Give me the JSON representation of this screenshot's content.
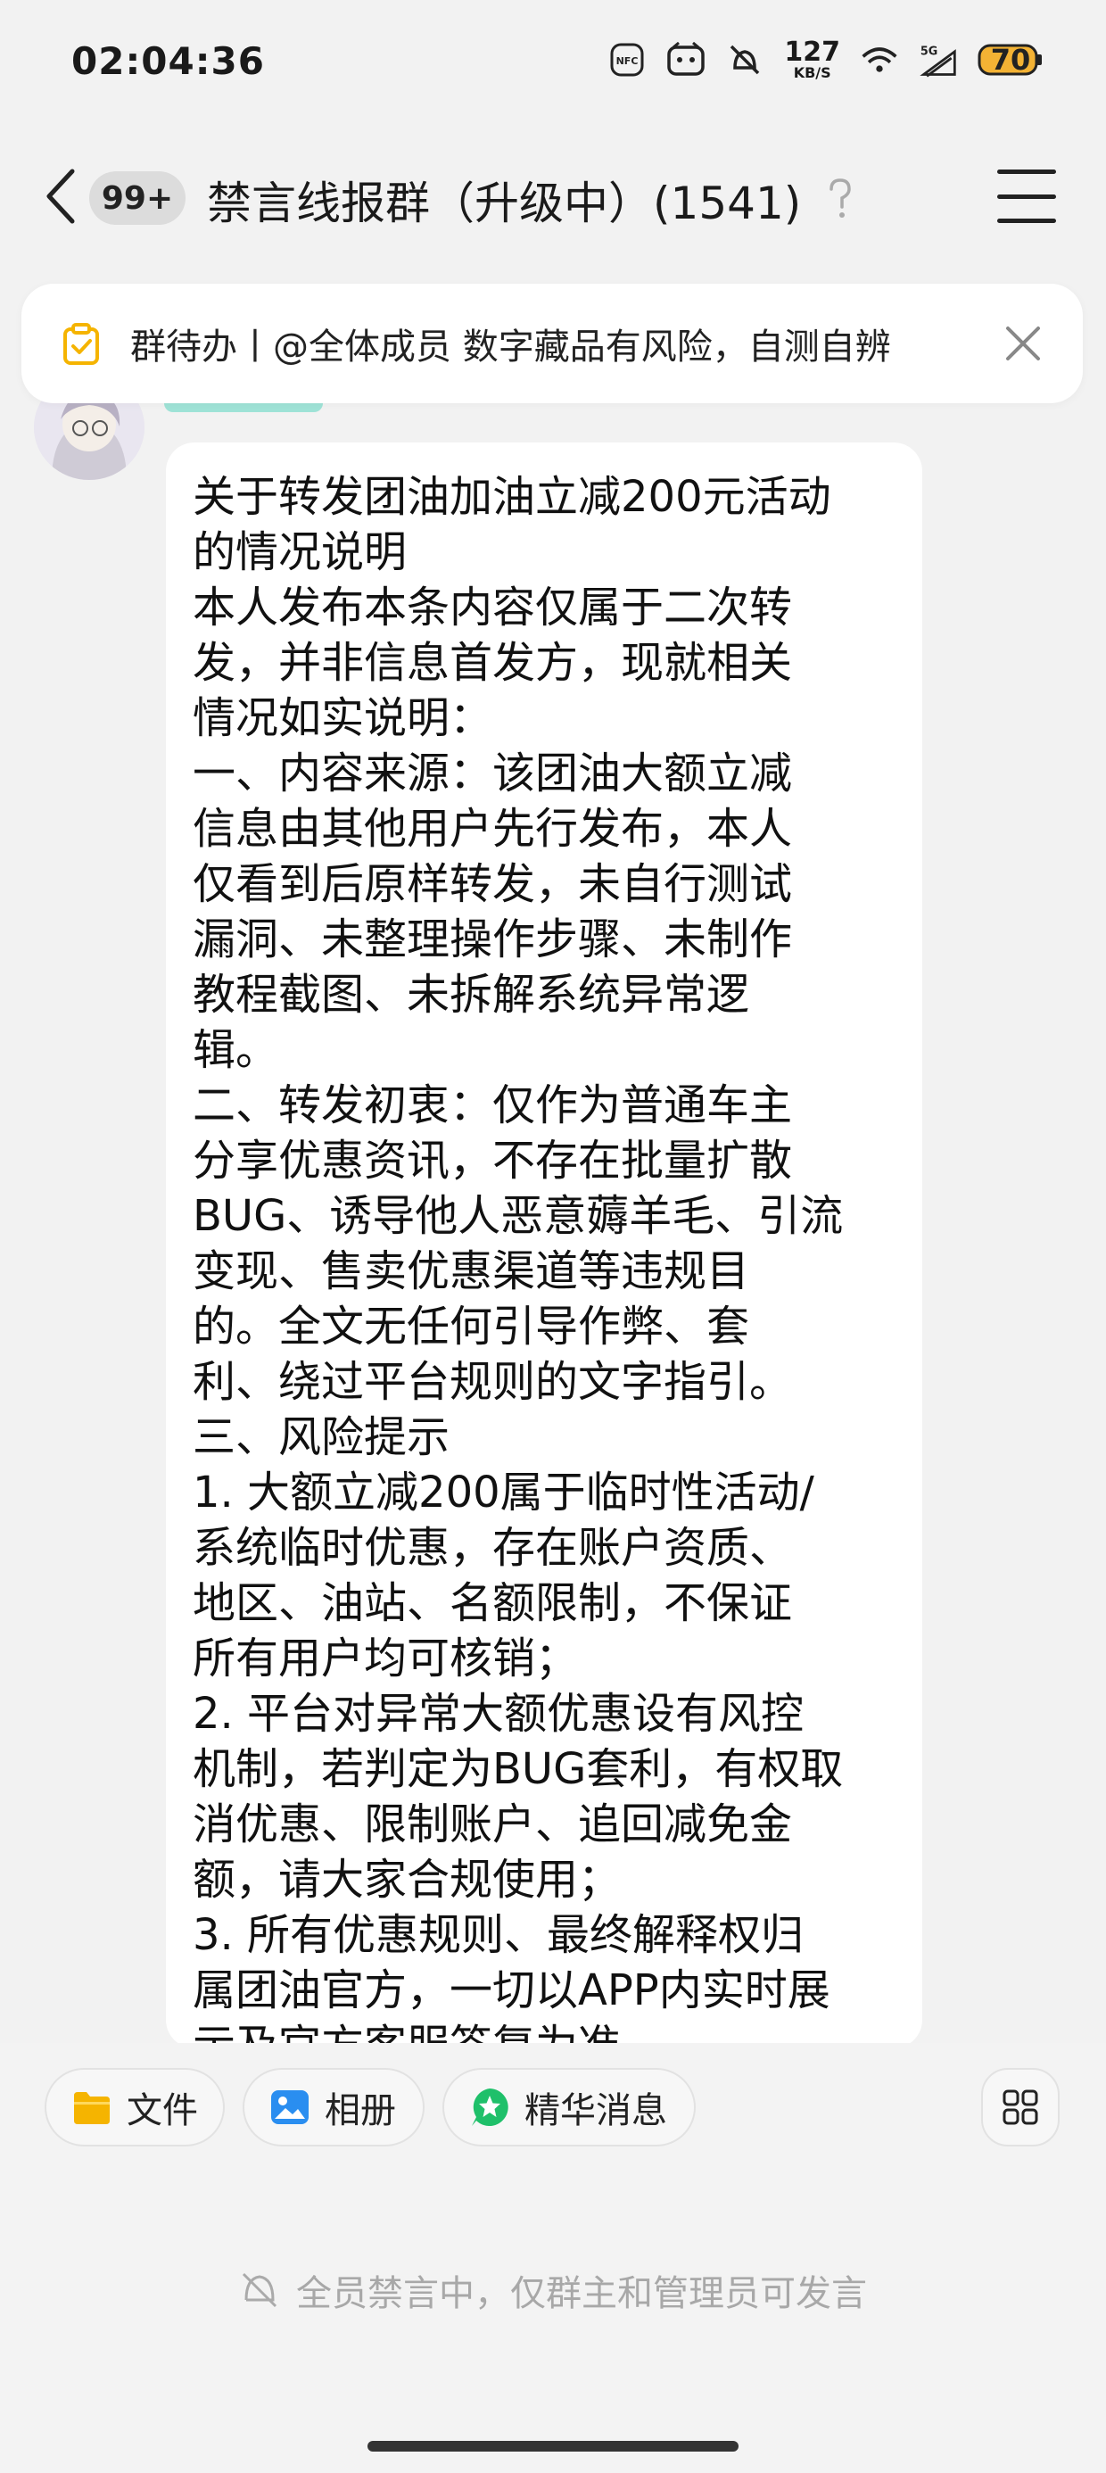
{
  "status_bar": {
    "time": "02:04:36",
    "speed_value": "127",
    "speed_unit": "KB/S",
    "nfc_label": "NFC",
    "network_label": "5G",
    "battery": "70",
    "icons": [
      "nfc-icon",
      "notification-icon",
      "no-disturb-icon",
      "network-speed",
      "wifi-icon",
      "5g-signal-icon",
      "battery-icon"
    ]
  },
  "header": {
    "unread_count": "99+",
    "title": "禁言线报群（升级中）(1541)"
  },
  "banner": {
    "text": "群待办丨@全体成员 数字藏品有风险，自测自辨"
  },
  "message": {
    "text": "关于转发团油加油立减200元活动\n的情况说明\n本人发布本条内容仅属于二次转\n发，并非信息首发方，现就相关\n情况如实说明：\n一、内容来源：该团油大额立减\n信息由其他用户先行发布，本人\n仅看到后原样转发，未自行测试\n漏洞、未整理操作步骤、未制作\n教程截图、未拆解系统异常逻\n辑。\n二、转发初衷：仅作为普通车主\n分享优惠资讯，不存在批量扩散\nBUG、诱导他人恶意薅羊毛、引流\n变现、售卖优惠渠道等违规目\n的。全文无任何引导作弊、套\n利、绕过平台规则的文字指引。\n三、风险提示\n1. 大额立减200属于临时性活动/\n系统临时优惠，存在账户资质、\n地区、油站、名额限制，不保证\n所有用户均可核销；\n2. 平台对异常大额优惠设有风控\n机制，若判定为BUG套利，有权取\n消优惠、限制账户、追回减免金\n额，请大家合规使用；\n3. 所有优惠规则、最终解释权归\n属团油官方，一切以APP内实时展\n示及官方客服答复为准。"
  },
  "shortcuts": [
    {
      "label": "文件",
      "icon": "folder-icon",
      "color": "#f5b400"
    },
    {
      "label": "相册",
      "icon": "photo-icon",
      "color": "#2a8ef0"
    },
    {
      "label": "精华消息",
      "icon": "star-badge-icon",
      "color": "#1fc06a"
    }
  ],
  "mute_notice": "全员禁言中，仅群主和管理员可发言"
}
